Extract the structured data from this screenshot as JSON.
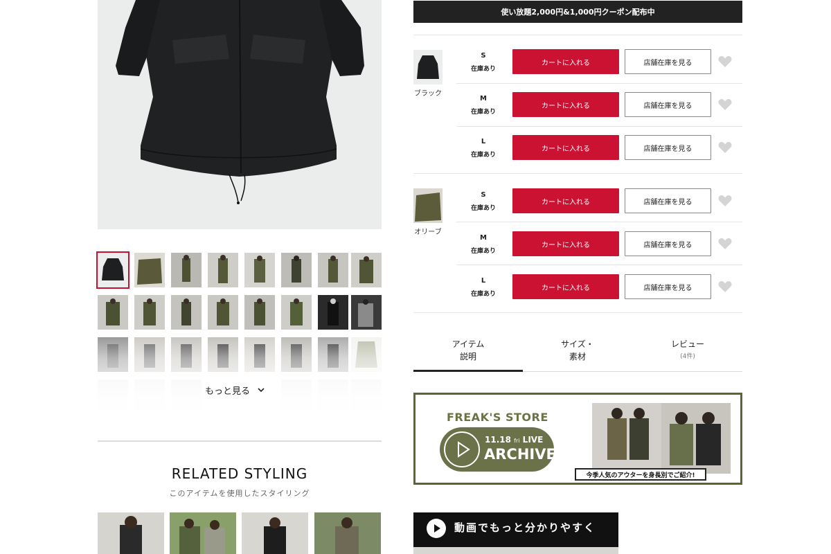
{
  "coupon_banner": "使い放題2,000円&1,000円クーポン配布中",
  "product_photos": {
    "selected_index": 0,
    "more_label": "もっと見る"
  },
  "variants": [
    {
      "color": "ブラック",
      "sizes": [
        {
          "size": "S",
          "stock": "在庫あり"
        },
        {
          "size": "M",
          "stock": "在庫あり"
        },
        {
          "size": "L",
          "stock": "在庫あり"
        }
      ]
    },
    {
      "color": "オリーブ",
      "sizes": [
        {
          "size": "S",
          "stock": "在庫あり"
        },
        {
          "size": "M",
          "stock": "在庫あり"
        },
        {
          "size": "L",
          "stock": "在庫あり"
        }
      ]
    }
  ],
  "buttons": {
    "cart_label": "カートに入れる",
    "store_label": "店舗在庫を見る"
  },
  "tabs": [
    {
      "line1": "アイテム",
      "line2": "説明",
      "active": true
    },
    {
      "line1": "サイズ・",
      "line2": "素材",
      "active": false
    },
    {
      "line1": "レビュー",
      "line2": "(4件)",
      "active": false
    }
  ],
  "live_banner": {
    "store": "FREAK'S STORE",
    "date": "11.18",
    "weekday": "fri",
    "live": "LIVE",
    "archive": "ARCHIVE",
    "caption": "今季人気のアウターを身長別でご紹介!"
  },
  "related": {
    "title": "RELATED STYLING",
    "subtitle": "このアイテムを使用したスタイリング"
  },
  "video_banner": {
    "text": "動画でもっと分かりやすく"
  },
  "colors": {
    "accent_red": "#cc1233",
    "coupon_bg": "#222222",
    "banner_olive": "#6b7149"
  }
}
